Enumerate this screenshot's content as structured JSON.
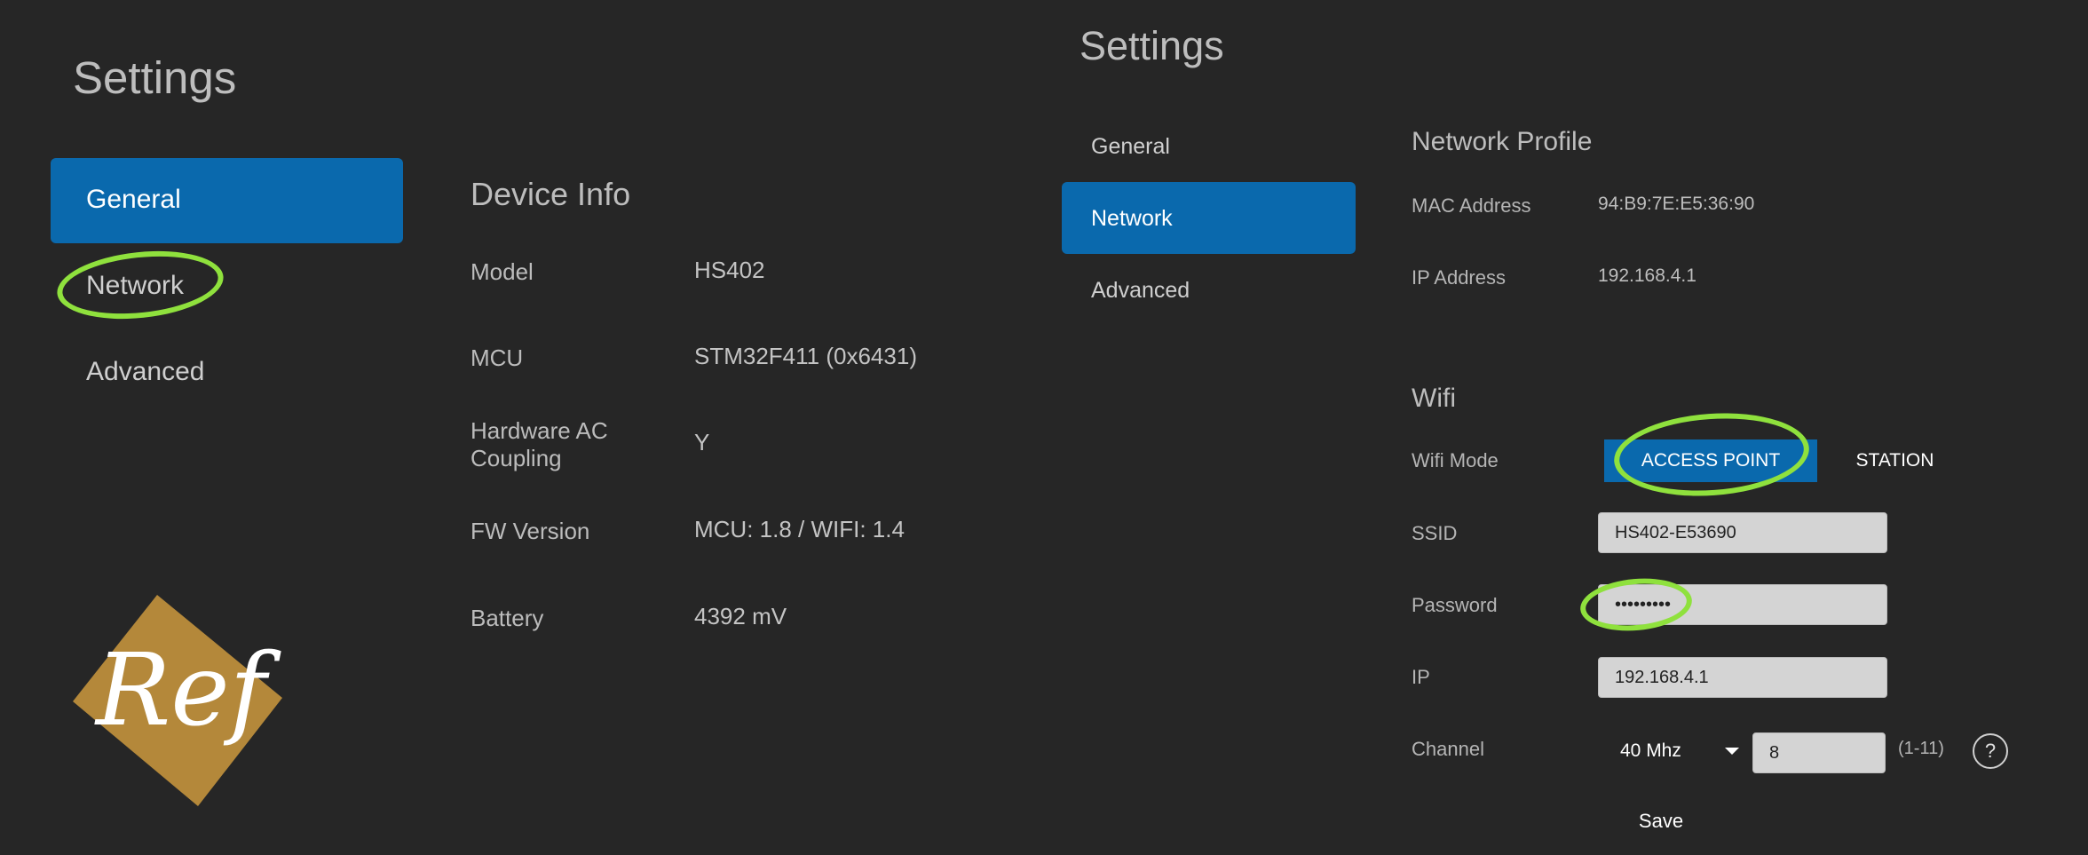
{
  "left_panel": {
    "title": "Settings",
    "nav": [
      {
        "label": "General",
        "active": true
      },
      {
        "label": "Network",
        "active": false
      },
      {
        "label": "Advanced",
        "active": false
      }
    ],
    "device_info": {
      "title": "Device Info",
      "rows": [
        {
          "label": "Model",
          "value": "HS402"
        },
        {
          "label": "MCU",
          "value": "STM32F411 (0x6431)"
        },
        {
          "label": "Hardware AC\nCoupling",
          "value": "Y"
        },
        {
          "label": "FW Version",
          "value": "MCU: 1.8 / WIFI: 1.4"
        },
        {
          "label": "Battery",
          "value": "4392 mV"
        }
      ]
    },
    "logo_text": "Ref"
  },
  "right_panel": {
    "title": "Settings",
    "nav": [
      {
        "label": "General",
        "active": false
      },
      {
        "label": "Network",
        "active": true
      },
      {
        "label": "Advanced",
        "active": false
      }
    ],
    "network_profile": {
      "title": "Network Profile",
      "mac_label": "MAC Address",
      "mac_value": "94:B9:7E:E5:36:90",
      "ip_label": "IP Address",
      "ip_value": "192.168.4.1"
    },
    "wifi": {
      "title": "Wifi",
      "mode_label": "Wifi Mode",
      "mode_options": [
        "ACCESS POINT",
        "STATION"
      ],
      "mode_selected": "ACCESS POINT",
      "ssid_label": "SSID",
      "ssid_value": "HS402-E53690",
      "password_label": "Password",
      "password_value": "•••••••••",
      "ip_label": "IP",
      "ip_value": "192.168.4.1",
      "channel_label": "Channel",
      "bandwidth_value": "40 Mhz",
      "channel_value": "8",
      "channel_range": "(1-11)",
      "help_glyph": "?",
      "save_label": "Save"
    }
  },
  "colors": {
    "background": "#262626",
    "accent": "#0a69ad",
    "annotation": "#8fe13d",
    "logo": "#b4883a"
  }
}
